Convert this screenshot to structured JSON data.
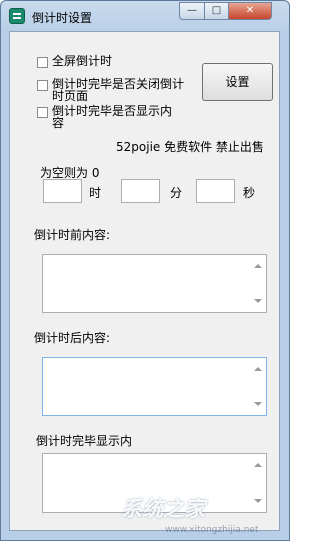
{
  "window": {
    "title": "倒计时设置",
    "controls": {
      "minimize": "—",
      "maximize": "□",
      "close": "✕"
    }
  },
  "options": {
    "fullscreen_label": "全屏倒计时",
    "close_page_label": "倒计时完毕是否关闭倒计时页面",
    "show_content_label": "倒计时完毕是否显示内容"
  },
  "settings_button_label": "设置",
  "footer_text": "52pojie 免费软件 禁止出售",
  "time": {
    "empty_hint": "为空则为 0",
    "hours_unit": "时",
    "minutes_unit": "分",
    "seconds_unit": "秒",
    "hours_value": "",
    "minutes_value": "",
    "seconds_value": ""
  },
  "sections": {
    "before_label": "倒计时前内容:",
    "after_label": "倒计时后内容:",
    "finished_label": "倒计时完毕显示内",
    "before_value": "",
    "after_value": "",
    "finished_value": ""
  },
  "watermark": {
    "main": "系统之家",
    "sub": "www.xitongzhijia.net"
  },
  "colors": {
    "close_button": "#c7462c",
    "titlebar": "#c9dbee",
    "client": "#f0f0f0"
  }
}
